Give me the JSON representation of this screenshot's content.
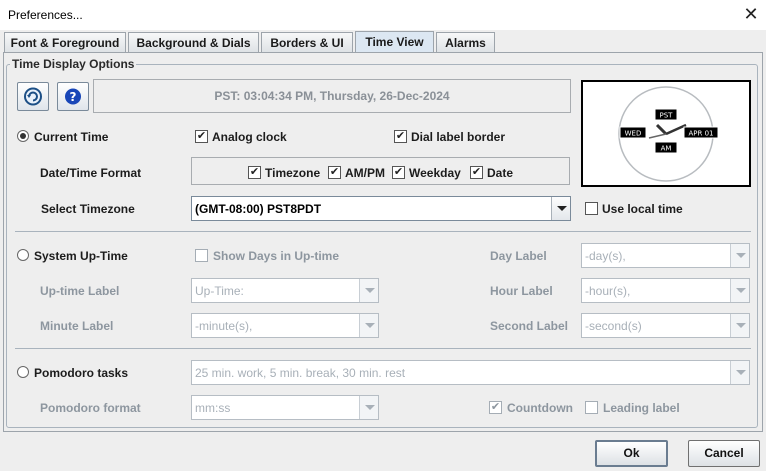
{
  "window": {
    "title": "Preferences...",
    "close_icon": "close-icon"
  },
  "tabs": [
    {
      "label": "Font & Foreground",
      "selected": false
    },
    {
      "label": "Background & Dials",
      "selected": false
    },
    {
      "label": "Borders & UI",
      "selected": false
    },
    {
      "label": "Time View",
      "selected": true
    },
    {
      "label": "Alarms",
      "selected": false
    }
  ],
  "group": {
    "title": "Time Display Options"
  },
  "toolbar": {
    "sync_icon": "refresh-icon",
    "help_icon": "help-icon"
  },
  "time_display": "PST: 03:04:34 PM, Thursday, 26-Dec-2024",
  "clock_preview": {
    "top_label": "PST",
    "left_label": "WED",
    "right_label": "APR 01",
    "bottom_label": "AM"
  },
  "current_time": {
    "radio_label": "Current Time",
    "selected": true,
    "analog_clock": {
      "label": "Analog clock",
      "checked": true
    },
    "dial_label_border": {
      "label": "Dial label border",
      "checked": true
    },
    "format_label": "Date/Time Format",
    "format_options": [
      {
        "label": "Timezone",
        "checked": true
      },
      {
        "label": "AM/PM",
        "checked": true
      },
      {
        "label": "Weekday",
        "checked": true
      },
      {
        "label": "Date",
        "checked": true
      }
    ],
    "timezone_label": "Select Timezone",
    "timezone_value": "(GMT-08:00)  PST8PDT",
    "use_local_time": {
      "label": "Use local time",
      "checked": false
    }
  },
  "system_uptime": {
    "radio_label": "System Up-Time",
    "selected": false,
    "show_days": {
      "label": "Show Days in Up-time",
      "checked": false
    },
    "day_label": {
      "label": "Day Label",
      "value": "-day(s),"
    },
    "uptime_label": {
      "label": "Up-time Label",
      "value": "Up-Time:"
    },
    "hour_label": {
      "label": "Hour Label",
      "value": "-hour(s),"
    },
    "minute_label": {
      "label": "Minute Label",
      "value": "-minute(s),"
    },
    "second_label": {
      "label": "Second Label",
      "value": "-second(s)"
    }
  },
  "pomodoro": {
    "radio_label": "Pomodoro tasks",
    "selected": false,
    "tasks_value": "25 min. work, 5 min. break, 30 min. rest",
    "format_label": "Pomodoro format",
    "format_value": "mm:ss",
    "countdown": {
      "label": "Countdown",
      "checked": true
    },
    "leading_label": {
      "label": "Leading label",
      "checked": false
    }
  },
  "buttons": {
    "ok": "Ok",
    "cancel": "Cancel"
  },
  "colors": {
    "accent": "#dce7f2",
    "disabled_text": "#8d969f",
    "panel_bg": "#eeeeee"
  }
}
